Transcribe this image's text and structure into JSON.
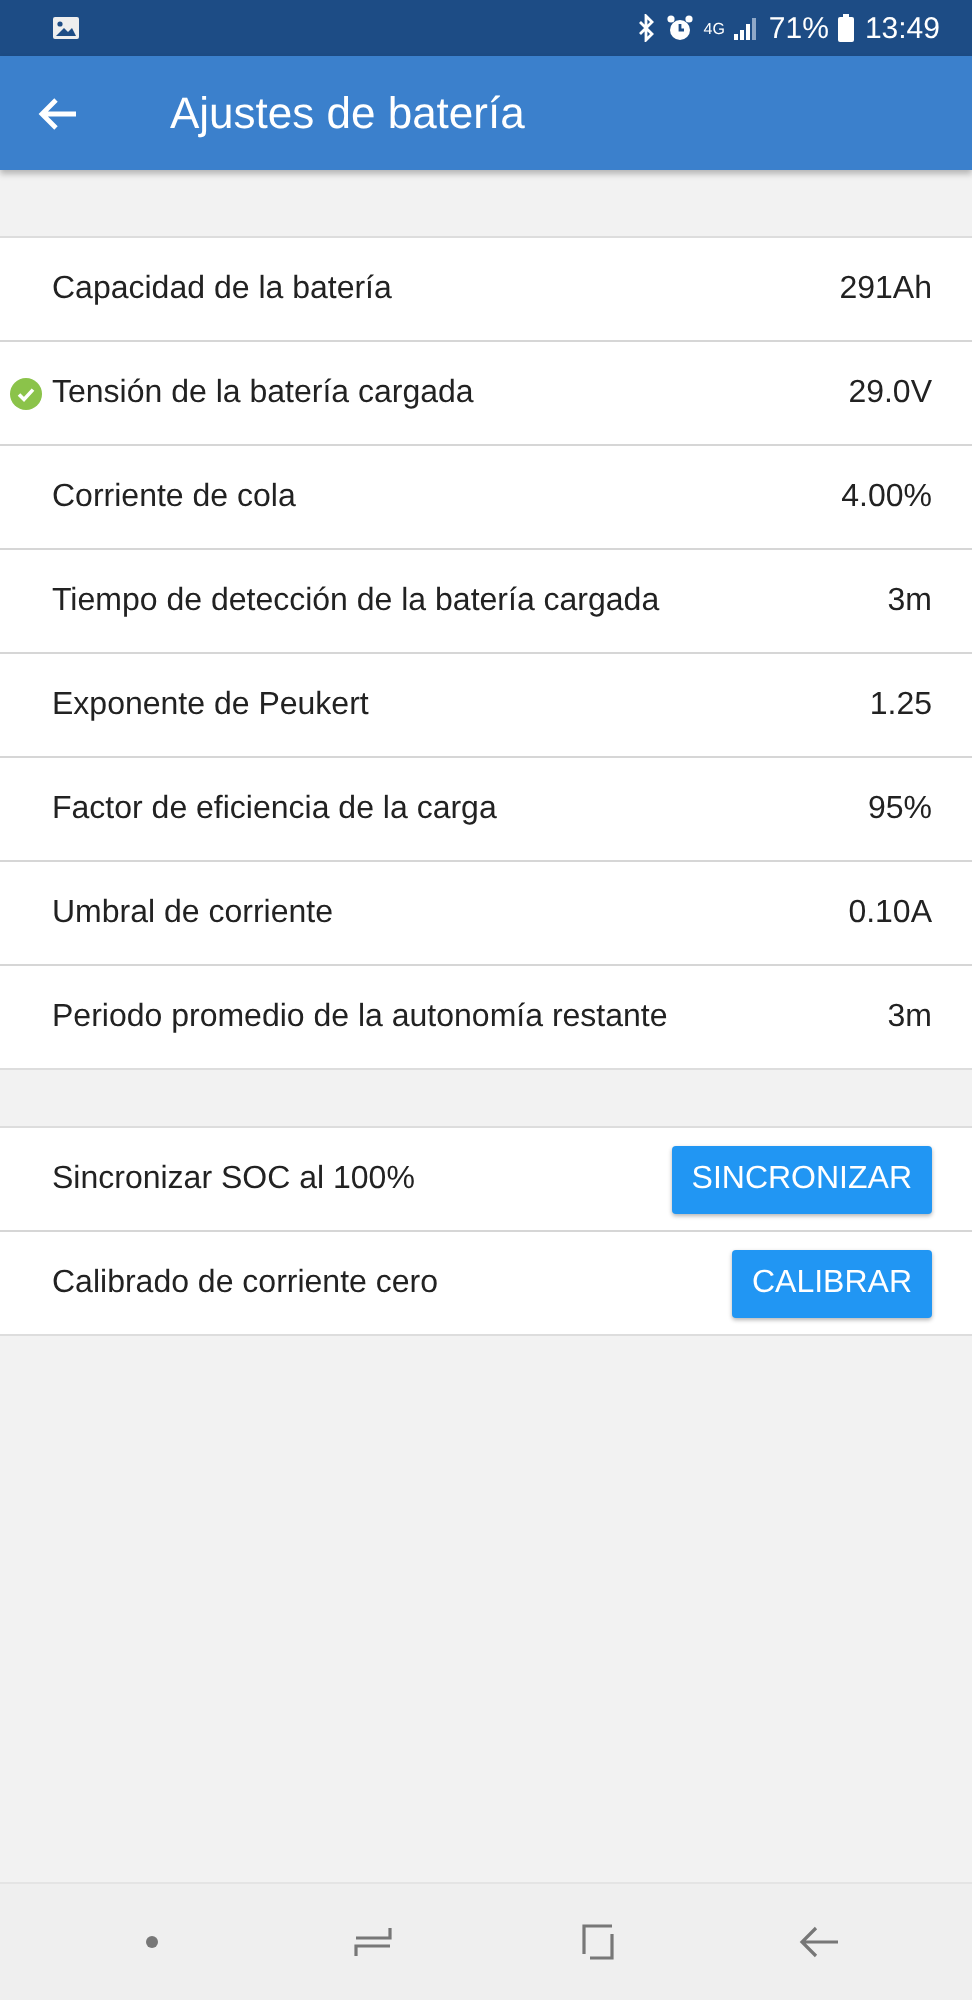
{
  "status_bar": {
    "network": "4G",
    "battery": "71%",
    "time": "13:49"
  },
  "app_bar": {
    "title": "Ajustes de batería"
  },
  "settings": [
    {
      "label": "Capacidad de la batería",
      "value": "291Ah",
      "verified": false
    },
    {
      "label": "Tensión de la batería cargada",
      "value": "29.0V",
      "verified": true
    },
    {
      "label": "Corriente de cola",
      "value": "4.00%",
      "verified": false
    },
    {
      "label": "Tiempo de detección de la batería cargada",
      "value": "3m",
      "verified": false
    },
    {
      "label": "Exponente de Peukert",
      "value": "1.25",
      "verified": false
    },
    {
      "label": "Factor de eficiencia de la carga",
      "value": "95%",
      "verified": false
    },
    {
      "label": "Umbral de corriente",
      "value": "0.10A",
      "verified": false
    },
    {
      "label": "Periodo promedio de la autonomía restante",
      "value": "3m",
      "verified": false
    }
  ],
  "actions": [
    {
      "label": "Sincronizar SOC al 100%",
      "button": "SINCRONIZAR"
    },
    {
      "label": "Calibrado de corriente cero",
      "button": "CALIBRAR"
    }
  ]
}
